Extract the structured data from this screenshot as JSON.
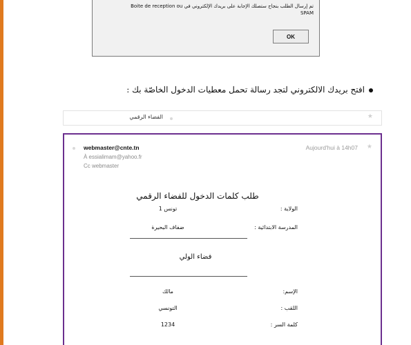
{
  "dialog": {
    "message_line1": "تم إرسال الطلب بنجاح ستصلك الإجابة على بريدك الإلكتروني في  Boite de reception ou",
    "message_line2": "SPAM",
    "ok_label": "OK"
  },
  "instruction": {
    "text": "افتح بريدك الالكتروني لتجد رسالة تحمل معطيات الدخول الخاصّة بك :"
  },
  "folder": {
    "label": "الفضاء الرقمي"
  },
  "email": {
    "sender": "webmaster@cnte.tn",
    "to": "À  essialimam@yahoo.fr",
    "cc": "Cc  webmaster",
    "date": "Aujourd'hui à 14h07",
    "form_title": "طلب كلمات الدخول للفضاء الرقمي",
    "fields": [
      {
        "label": "الولاية :",
        "value": "تونس 1"
      },
      {
        "label": "المدرسة الابتدائية :",
        "value": "ضفاف البحيرة"
      }
    ],
    "space_name": "فضاء الولي",
    "user_fields": [
      {
        "label": "الإسم:",
        "value": "مالك"
      },
      {
        "label": "اللقب :",
        "value": "التونسي"
      },
      {
        "label": "كلمة السر :",
        "value": "1234"
      }
    ]
  },
  "colors": {
    "accent_left_bar": "#e07a1f",
    "email_border": "#6b2e8e"
  }
}
